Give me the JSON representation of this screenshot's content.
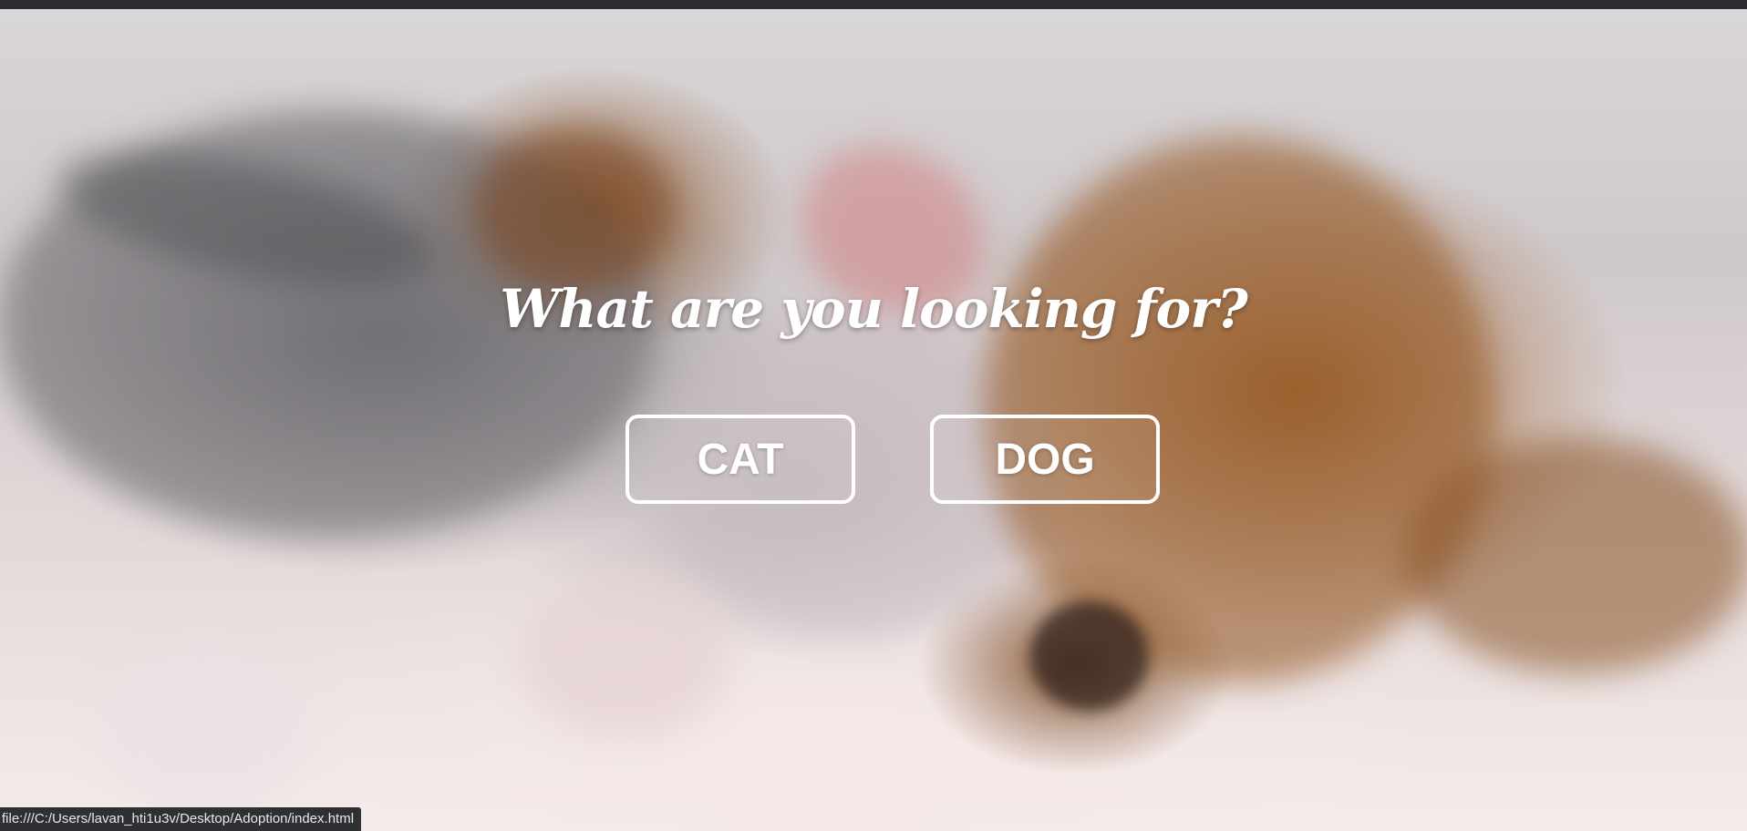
{
  "page": {
    "headline": "What are you looking for?"
  },
  "choices": [
    {
      "label": "CAT"
    },
    {
      "label": "DOG"
    }
  ],
  "status_bar": {
    "url": "file:///C:/Users/lavan_hti1u3v/Desktop/Adoption/index.html"
  },
  "background": {
    "image_subject": "kitten and puppy sleeping together"
  },
  "colors": {
    "text": "#ffffff",
    "button_border": "#ffffff",
    "status_bar_bg": "#2e3034"
  }
}
